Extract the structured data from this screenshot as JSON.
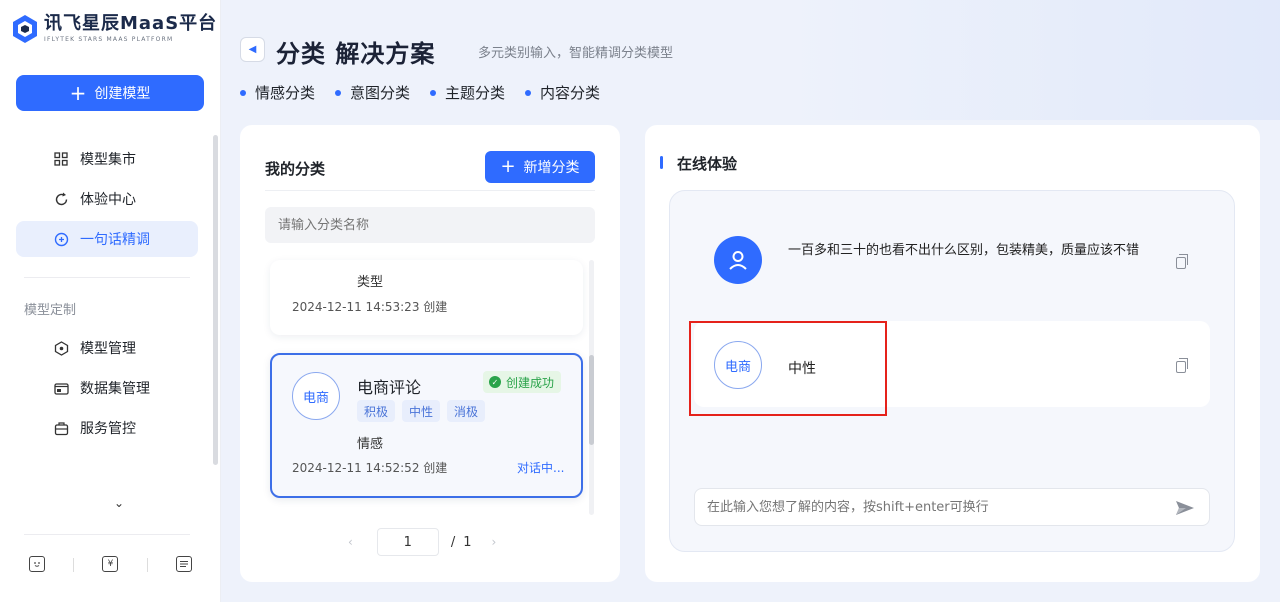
{
  "sidebar": {
    "logo_main": "讯飞星辰MaaS平台",
    "logo_sub": "IFLYTEK STARS MAAS PLATFORM",
    "create_button": "创建模型",
    "nav_items": [
      {
        "label": "模型集市",
        "icon": "grid-icon"
      },
      {
        "label": "体验中心",
        "icon": "refresh-icon"
      },
      {
        "label": "一句话精调",
        "icon": "tune-icon"
      }
    ],
    "section_title": "模型定制",
    "custom_items": [
      {
        "label": "模型管理",
        "icon": "model-icon"
      },
      {
        "label": "数据集管理",
        "icon": "dataset-icon"
      },
      {
        "label": "服务管控",
        "icon": "service-icon"
      }
    ],
    "expand_icon": "⌄",
    "bottom_icons": [
      "feedback-icon",
      "billing-icon",
      "docs-icon"
    ]
  },
  "header": {
    "title": "分类 解决方案",
    "subtitle": "多元类别输入，智能精调分类模型",
    "types": [
      "情感分类",
      "意图分类",
      "主题分类",
      "内容分类"
    ]
  },
  "left_panel": {
    "title": "我的分类",
    "add_button": "新增分类",
    "search_placeholder": "请输入分类名称",
    "cards": [
      {
        "type": "类型",
        "date": "2024-12-11 14:53:23 创建"
      },
      {
        "avatar": "电商",
        "title": "电商评论",
        "status": "创建成功",
        "labels": [
          "积极",
          "中性",
          "消极"
        ],
        "type": "情感",
        "date": "2024-12-11 14:52:52 创建",
        "link": "对话中..."
      }
    ],
    "pager": {
      "prev": "‹",
      "current": "1",
      "separator": "/",
      "total": "1",
      "next": "›"
    }
  },
  "right_panel": {
    "title": "在线体验",
    "user_message": "一百多和三十的也看不出什么区别，包装精美，质量应该不错",
    "bot_avatar": "电商",
    "bot_reply": "中性",
    "input_placeholder": "在此输入您想了解的内容，按shift+enter可换行"
  },
  "colors": {
    "accent": "#2f6bff",
    "success": "#2aa34a",
    "highlight": "#e5221b"
  }
}
